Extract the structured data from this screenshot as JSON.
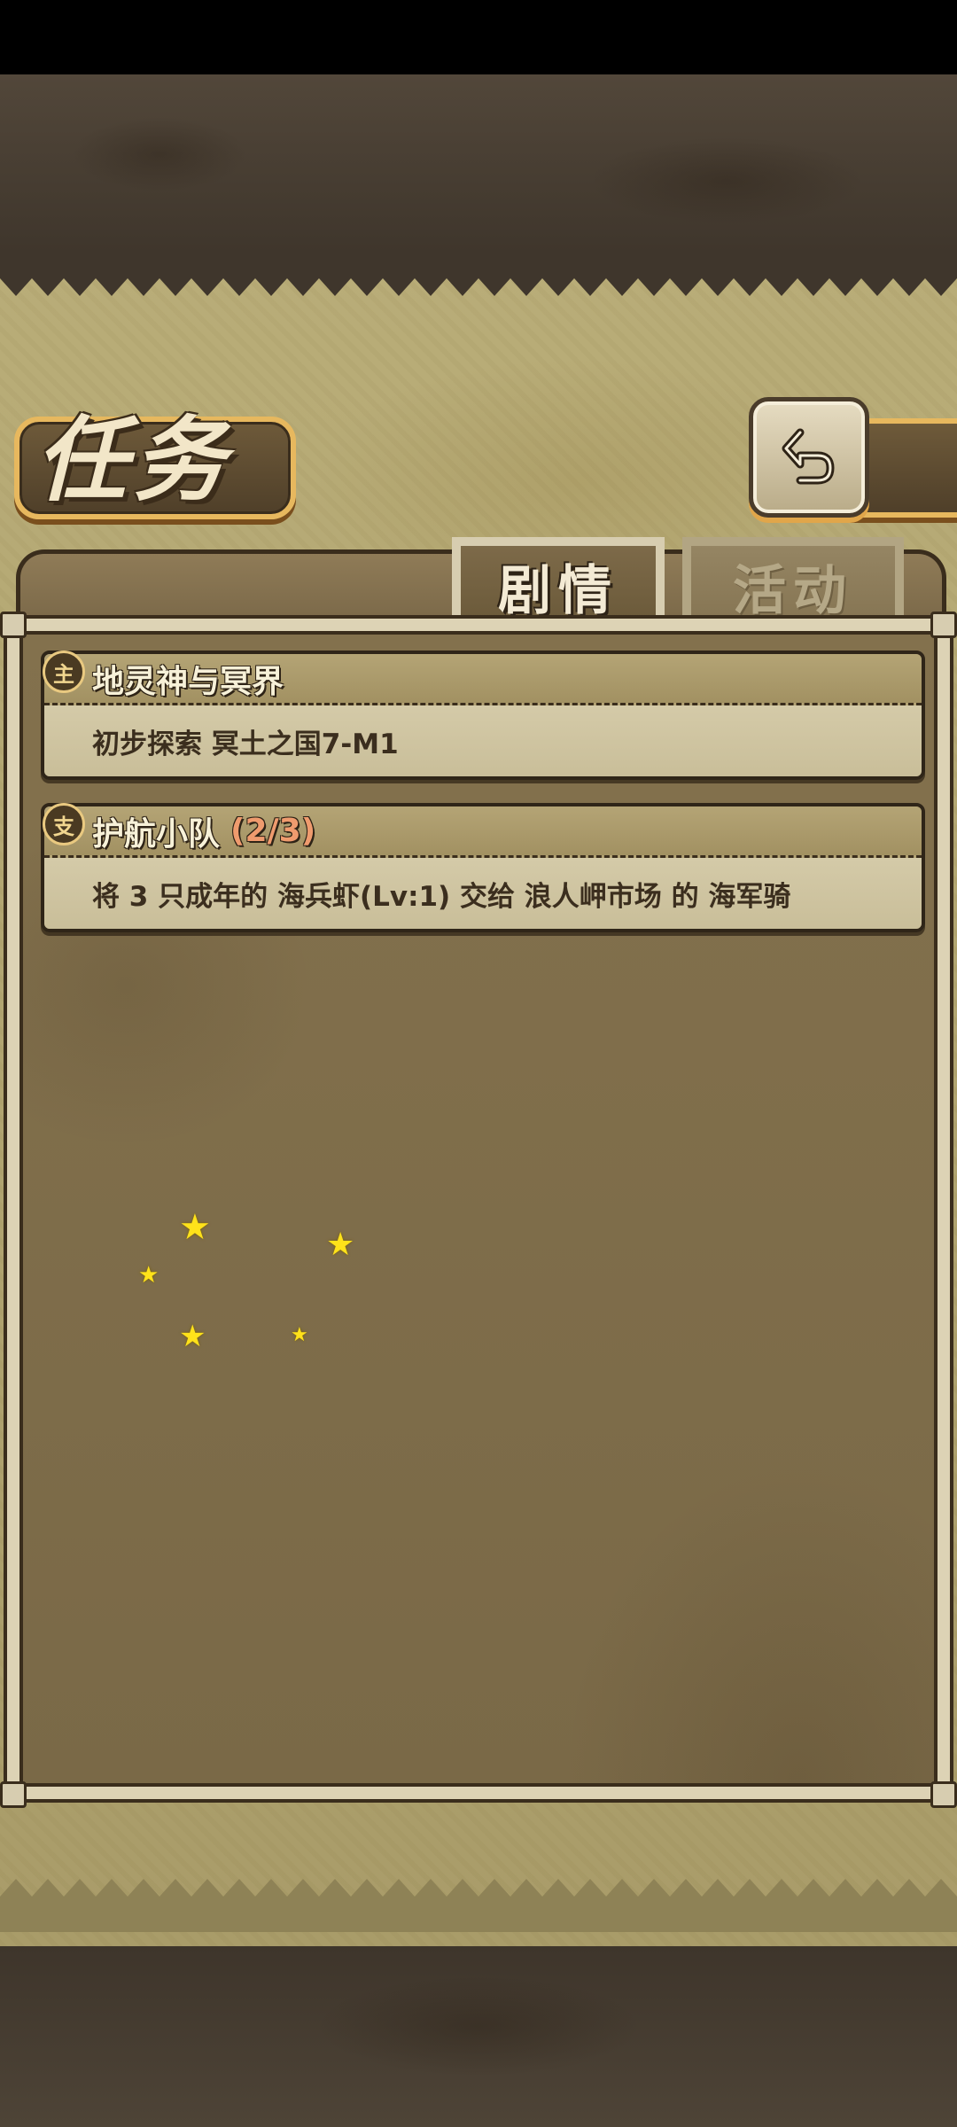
{
  "header": {
    "title": "任务",
    "back_icon": "return-arrow-icon"
  },
  "tabs": [
    {
      "label": "剧情",
      "active": true
    },
    {
      "label": "活动",
      "active": false
    }
  ],
  "quests": [
    {
      "type_icon_label": "主",
      "title": "地灵神与冥界",
      "progress": "",
      "description": "初步探索 冥土之国7-M1"
    },
    {
      "type_icon_label": "支",
      "title": "护航小队",
      "progress": "(2/3)",
      "description": "将 3 只成年的 海兵虾(Lv:1) 交给 浪人岬市场 的 海军骑"
    }
  ],
  "colors": {
    "accent_orange": "#e7b85e",
    "progress_text": "#ef9b6e",
    "star": "#ffe21a"
  }
}
